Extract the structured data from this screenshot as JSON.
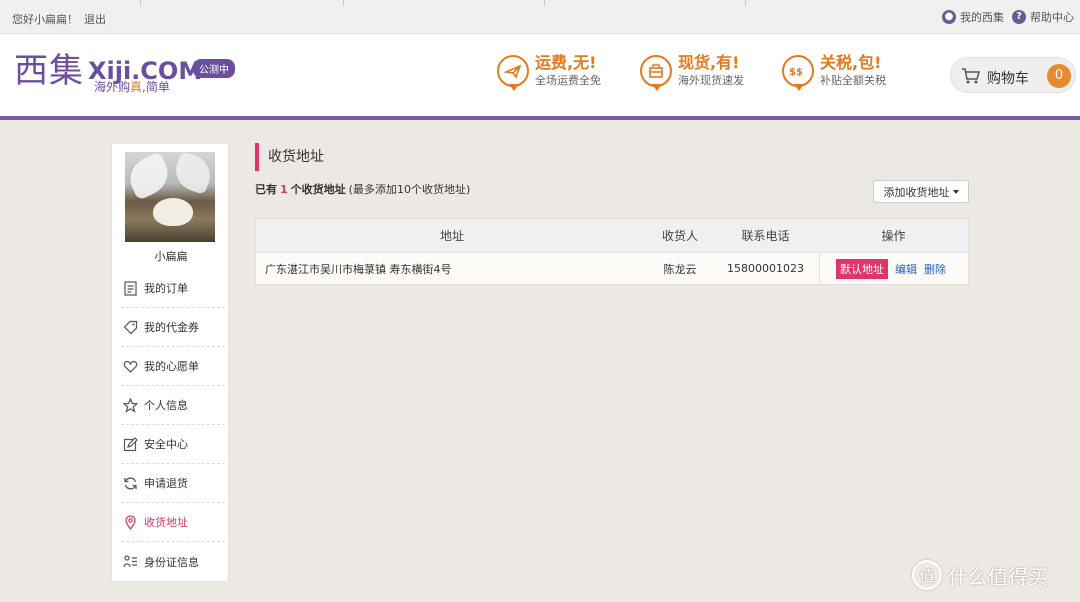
{
  "topbar": {
    "greeting": "您好小扁扁！",
    "logout": "退出",
    "my_xiji": "我的西集",
    "help": "帮助中心"
  },
  "header": {
    "logo_cn": "西集",
    "logo_en": "Xiji.COM",
    "badge": "公测中",
    "slogan_prefix": "海外购",
    "slogan_highlight": "真",
    "slogan_suffix": ",简单",
    "promos": [
      {
        "icon": "plane-icon",
        "title": "运费,无!",
        "subtitle": "全场运费全免"
      },
      {
        "icon": "basket-icon",
        "title": "现货,有!",
        "subtitle": "海外现货速发"
      },
      {
        "icon": "money-icon",
        "title": "关税,包!",
        "subtitle": "补贴全额关税"
      }
    ],
    "cart_label": "购物车",
    "cart_count": "0"
  },
  "sidebar": {
    "username": "小扁扁",
    "items": [
      {
        "label": "我的订单",
        "icon": "order-icon"
      },
      {
        "label": "我的代金券",
        "icon": "coupon-icon"
      },
      {
        "label": "我的心愿单",
        "icon": "heart-icon"
      },
      {
        "label": "个人信息",
        "icon": "star-icon"
      },
      {
        "label": "安全中心",
        "icon": "edit-icon"
      },
      {
        "label": "申请退货",
        "icon": "refresh-icon"
      },
      {
        "label": "收货地址",
        "icon": "location-icon",
        "active": true
      },
      {
        "label": "身份证信息",
        "icon": "id-card-icon"
      }
    ]
  },
  "main": {
    "title": "收货地址",
    "summary_prefix": "已有",
    "summary_count": "1",
    "summary_suffix": "个收货地址",
    "summary_note": "(最多添加10个收货地址)",
    "add_button": "添加收货地址",
    "table": {
      "headers": [
        "地址",
        "收货人",
        "联系电话",
        "操作"
      ],
      "rows": [
        {
          "address": "广东湛江市吴川市梅菉镇 寿东横街4号",
          "recipient": "陈龙云",
          "phone": "15800001023",
          "default_label": "默认地址",
          "edit": "编辑",
          "delete": "删除"
        }
      ]
    }
  },
  "watermark": {
    "badge": "值",
    "text": "什么值得买"
  },
  "colors": {
    "brand_purple": "#6a4f9e",
    "accent_orange": "#e6791c",
    "accent_pink": "#e0356a",
    "link_blue": "#2a62c0"
  }
}
